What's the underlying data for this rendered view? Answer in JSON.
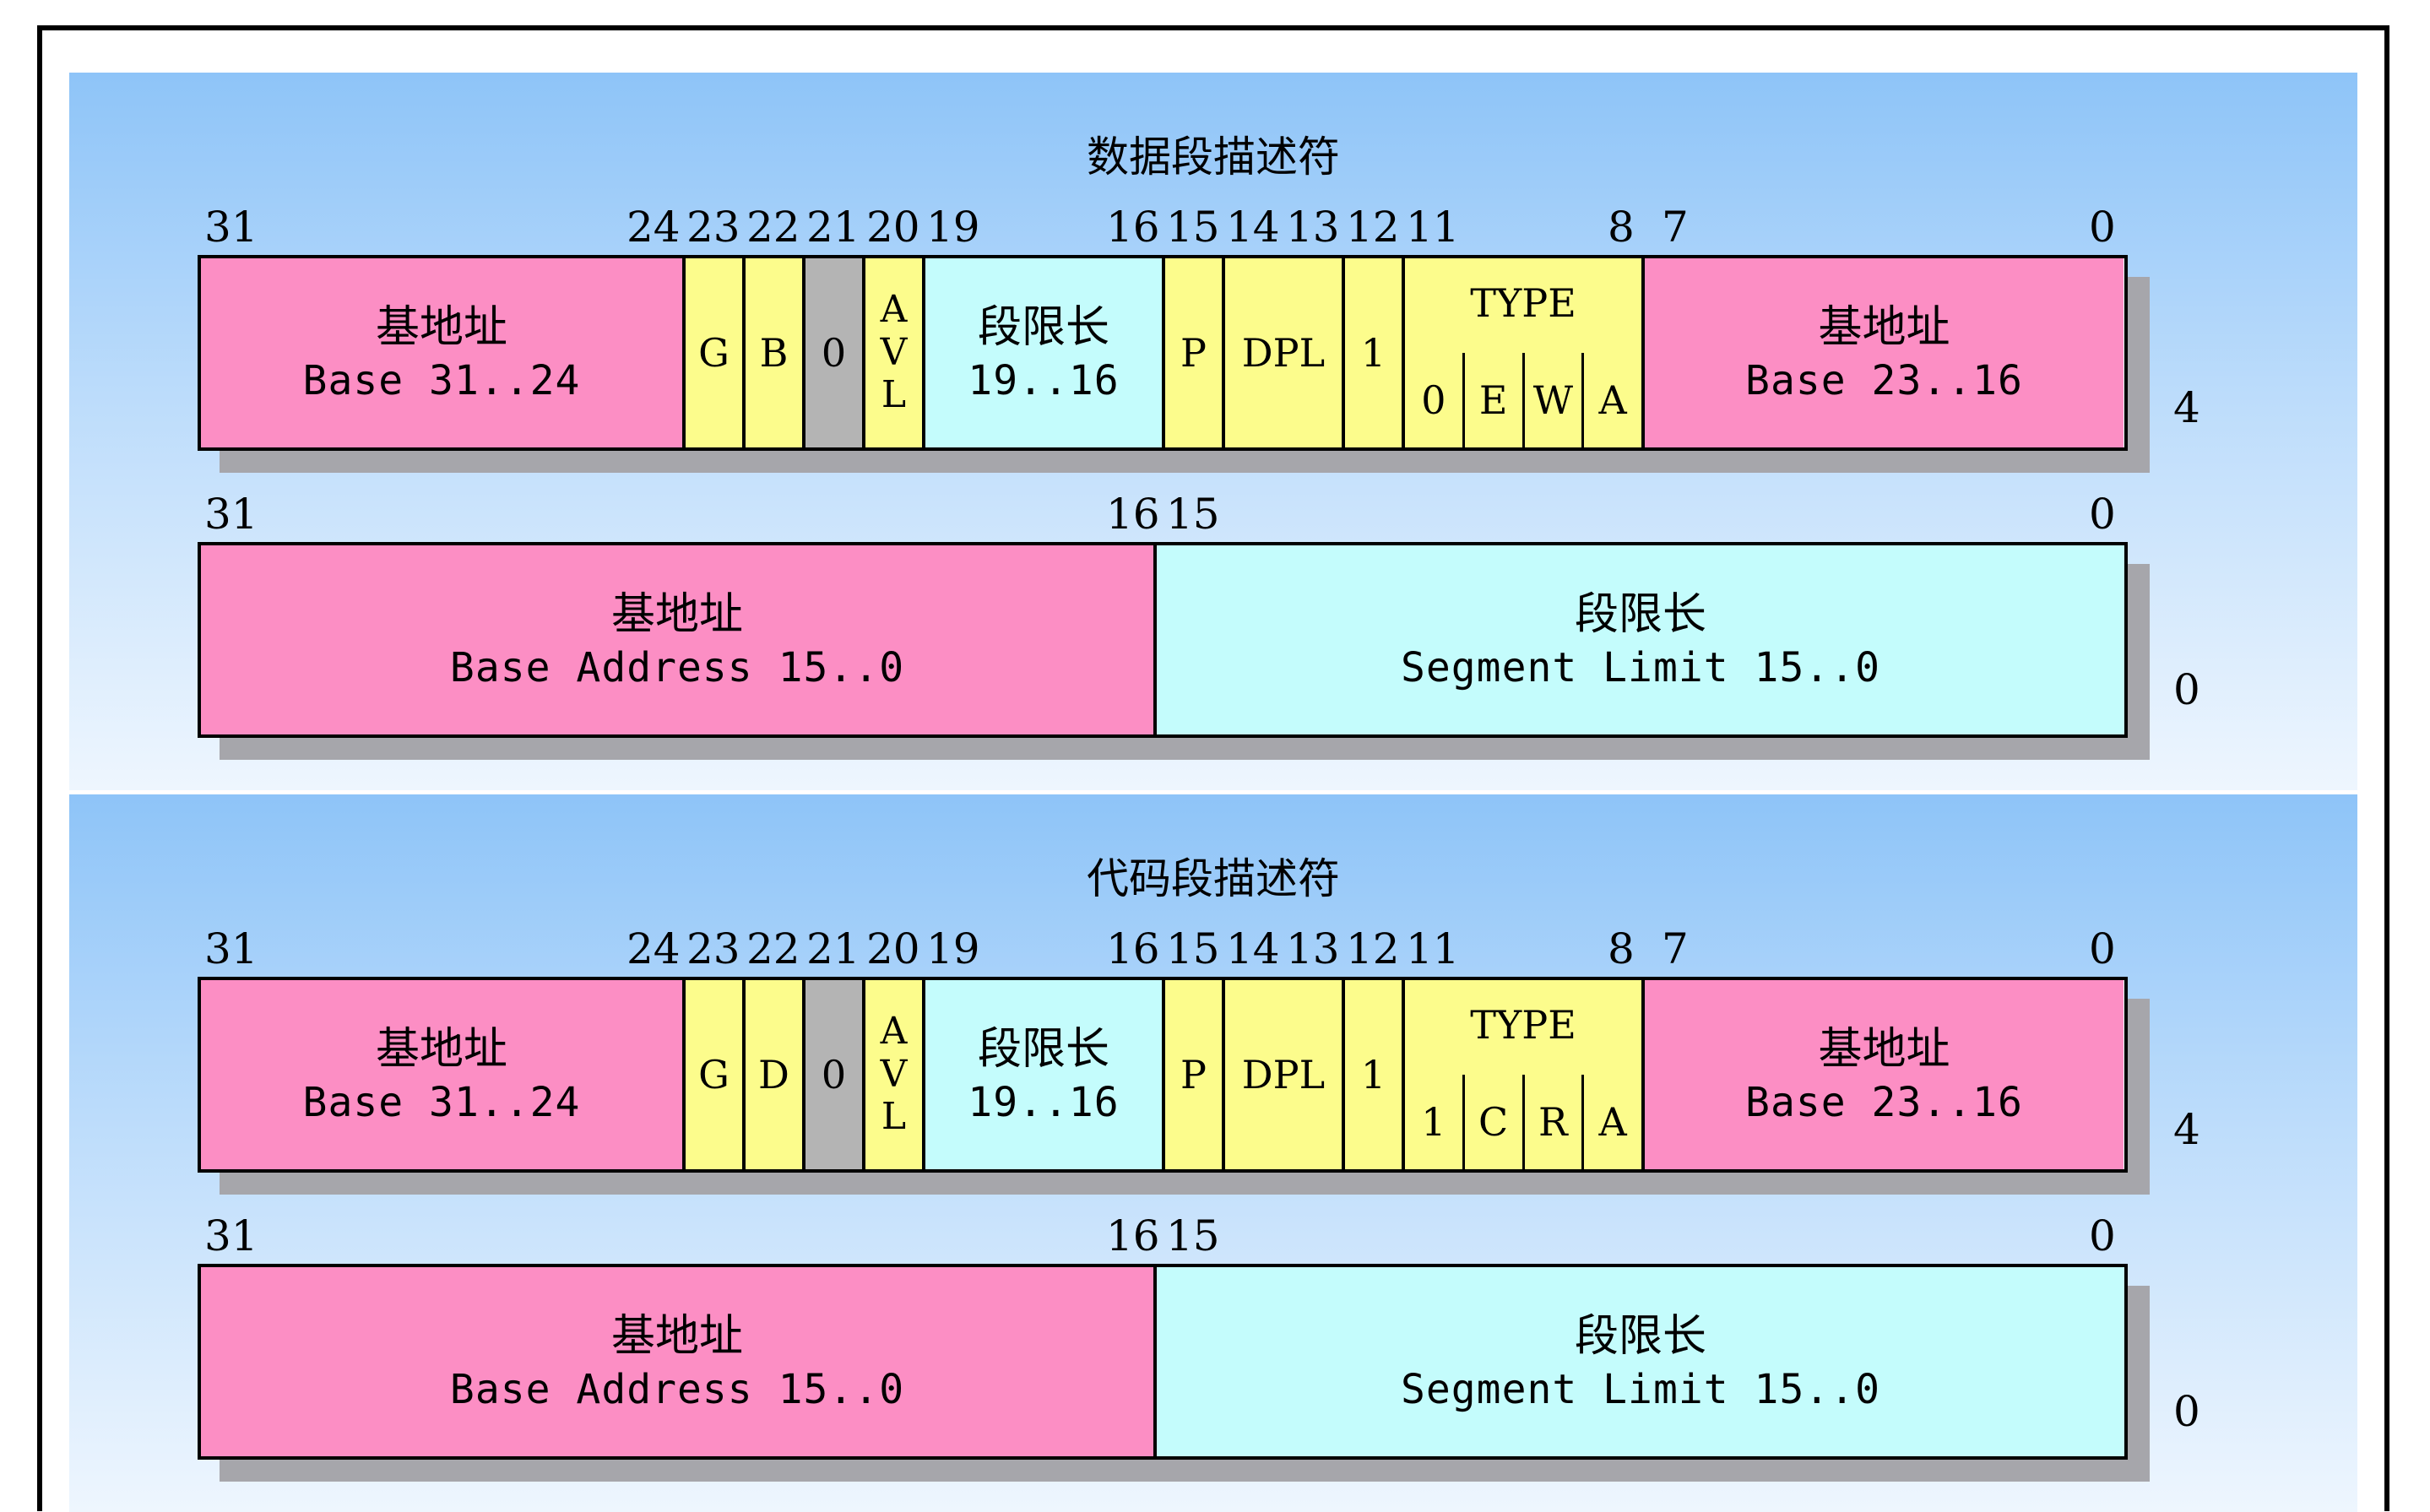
{
  "data_descriptor": {
    "title": "数据段描述符",
    "high_bits": [
      "31",
      "24",
      "23",
      "22",
      "21",
      "20",
      "19",
      "16",
      "15",
      "14",
      "13",
      "12",
      "11",
      "8",
      "7",
      "0"
    ],
    "high": {
      "base_hi_cn": "基地址",
      "base_hi_en": "Base 31..24",
      "g": "G",
      "b": "B",
      "zero": "0",
      "avl": [
        "A",
        "V",
        "L"
      ],
      "limit_cn": "段限长",
      "limit_en": "19..16",
      "p": "P",
      "dpl": "DPL",
      "one": "1",
      "type_label": "TYPE",
      "type_bits": [
        "0",
        "E",
        "W",
        "A"
      ],
      "base_mid_cn": "基地址",
      "base_mid_en": "Base 23..16"
    },
    "high_offset": "4",
    "low_bits": [
      "31",
      "16",
      "15",
      "0"
    ],
    "low": {
      "base_cn": "基地址",
      "base_en": "Base Address 15..0",
      "limit_cn": "段限长",
      "limit_en": "Segment Limit 15..0"
    },
    "low_offset": "0"
  },
  "code_descriptor": {
    "title": "代码段描述符",
    "high_bits": [
      "31",
      "24",
      "23",
      "22",
      "21",
      "20",
      "19",
      "16",
      "15",
      "14",
      "13",
      "12",
      "11",
      "8",
      "7",
      "0"
    ],
    "high": {
      "base_hi_cn": "基地址",
      "base_hi_en": "Base 31..24",
      "g": "G",
      "b": "D",
      "zero": "0",
      "avl": [
        "A",
        "V",
        "L"
      ],
      "limit_cn": "段限长",
      "limit_en": "19..16",
      "p": "P",
      "dpl": "DPL",
      "one": "1",
      "type_label": "TYPE",
      "type_bits": [
        "1",
        "C",
        "R",
        "A"
      ],
      "base_mid_cn": "基地址",
      "base_mid_en": "Base 23..16"
    },
    "high_offset": "4",
    "low_bits": [
      "31",
      "16",
      "15",
      "0"
    ],
    "low": {
      "base_cn": "基地址",
      "base_en": "Base Address 15..0",
      "limit_cn": "段限长",
      "limit_en": "Segment Limit 15..0"
    },
    "low_offset": "0"
  }
}
